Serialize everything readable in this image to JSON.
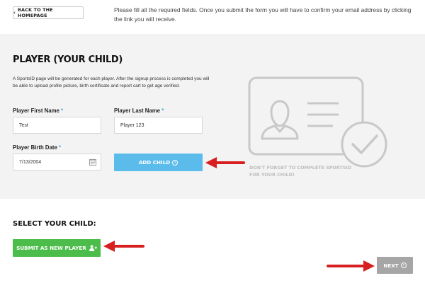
{
  "header": {
    "back_label": "BACK TO THE HOMEPAGE",
    "intro_text": "Please fill all the required fields. Once you submit the form you will have to confirm your email address by clicking the link you will receive."
  },
  "player_section": {
    "title": "PLAYER (YOUR CHILD)",
    "description": "A SportsID page will be generated for each player. After the signup process is completed you will be able to upload profile picture, birth certificate and report cart to get age verified.",
    "required_marker": "*",
    "first_name": {
      "label": "Player First Name",
      "value": "Test"
    },
    "last_name": {
      "label": "Player Last Name",
      "value": "Player 123"
    },
    "birth_date": {
      "label": "Player Birth Date",
      "value": "7/13/2004"
    },
    "add_child_label": "ADD CHILD",
    "sportsid_note": "DON'T FORGET TO COMPLETE SPORTSID FOR YOUR CHILD!"
  },
  "select_section": {
    "title": "SELECT YOUR CHILD:",
    "submit_new_label": "SUBMIT AS NEW PLAYER"
  },
  "footer": {
    "next_label": "NEXT"
  },
  "icons": {
    "back": "chevron-left-icon",
    "add_child": "circle-arrow-right-icon",
    "submit_new": "add-user-icon",
    "next": "circle-arrow-right-icon",
    "calendar": "calendar-icon",
    "id_card": "id-card-check-icon",
    "annotation": "red-arrow-icon"
  },
  "colors": {
    "add_child_bg": "#5bbcec",
    "submit_new_bg": "#4cbd4a",
    "next_bg": "#a6a6a6",
    "required_marker": "#3fa9d8",
    "annotation_arrow": "#d81f1f",
    "panel_bg": "#f3f3f3"
  }
}
